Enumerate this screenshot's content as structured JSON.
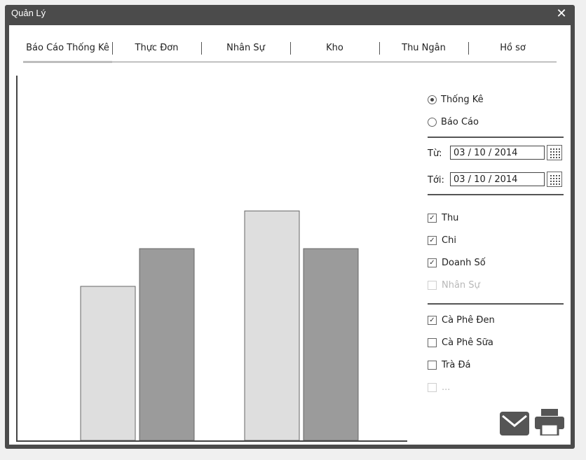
{
  "window": {
    "title": "Quản Lý",
    "close_symbol": "✕"
  },
  "tabs": [
    {
      "label": "Báo Cáo Thống Kê",
      "active": true
    },
    {
      "label": "Thực Đơn",
      "active": false
    },
    {
      "label": "Nhân Sự",
      "active": false
    },
    {
      "label": "Kho",
      "active": false
    },
    {
      "label": "Thu Ngân",
      "active": false
    },
    {
      "label": "Hồ sơ",
      "active": false
    }
  ],
  "mode": [
    {
      "label": "Thống Kê",
      "selected": true
    },
    {
      "label": "Báo Cáo",
      "selected": false
    }
  ],
  "dates": {
    "from_label": "Từ:",
    "from_value": "03 / 10 / 2014",
    "to_label": "Tới:",
    "to_value": "03 / 10 / 2014"
  },
  "metrics": [
    {
      "label": "Thu",
      "checked": true,
      "disabled": false
    },
    {
      "label": "Chi",
      "checked": true,
      "disabled": false
    },
    {
      "label": "Doanh Số",
      "checked": true,
      "disabled": false
    },
    {
      "label": "Nhân Sự",
      "checked": false,
      "disabled": true
    }
  ],
  "products": [
    {
      "label": "Cà Phê Đen",
      "checked": true,
      "disabled": false
    },
    {
      "label": "Cà Phê Sữa",
      "checked": false,
      "disabled": false
    },
    {
      "label": "Trà Đá",
      "checked": false,
      "disabled": false
    },
    {
      "label": "...",
      "checked": false,
      "disabled": true
    }
  ],
  "colors": {
    "bar_light": "#dedede",
    "bar_dark": "#9b9b9b",
    "axis": "#444444"
  },
  "chart_data": {
    "type": "bar",
    "categories": [
      "",
      ""
    ],
    "series": [
      {
        "values": [
          49,
          73
        ]
      },
      {
        "values": [
          61,
          61
        ]
      }
    ],
    "ylim": [
      0,
      100
    ],
    "title": "",
    "xlabel": "",
    "ylabel": "",
    "grid": false,
    "legend": "none"
  }
}
